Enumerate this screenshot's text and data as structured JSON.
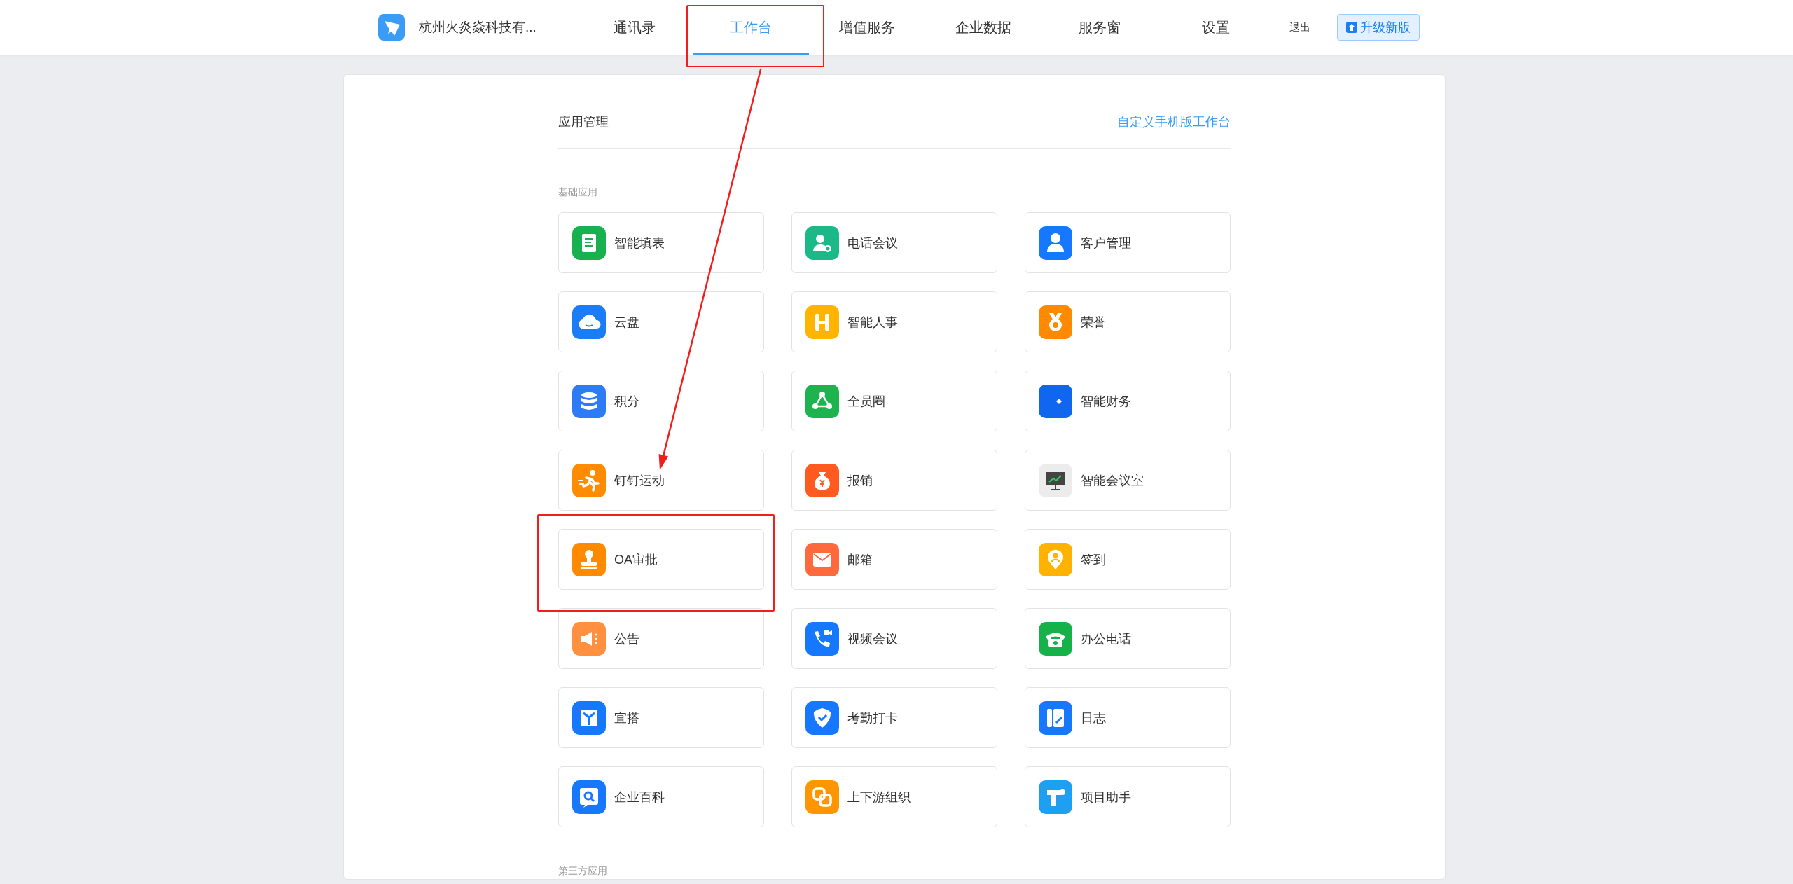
{
  "header": {
    "company": "杭州火炎焱科技有...",
    "tabs": [
      {
        "label": "通讯录",
        "selected": false,
        "highlighted": false
      },
      {
        "label": "工作台",
        "selected": true,
        "highlighted": true
      },
      {
        "label": "增值服务",
        "selected": false,
        "highlighted": false
      },
      {
        "label": "企业数据",
        "selected": false,
        "highlighted": false
      },
      {
        "label": "服务窗",
        "selected": false,
        "highlighted": false
      },
      {
        "label": "设置",
        "selected": false,
        "highlighted": false
      }
    ],
    "logout": "退出",
    "upgrade_button": "升级新版"
  },
  "panel": {
    "title": "应用管理",
    "customize_link": "自定义手机版工作台",
    "sections": [
      {
        "title": "基础应用",
        "apps": [
          {
            "label": "智能填表",
            "color": "#19b14f",
            "highlighted": false
          },
          {
            "label": "电话会议",
            "color": "#1bb987",
            "highlighted": false
          },
          {
            "label": "客户管理",
            "color": "#1677ff",
            "highlighted": false
          },
          {
            "label": "云盘",
            "color": "#1a7df5",
            "highlighted": false
          },
          {
            "label": "智能人事",
            "color": "#ffb400",
            "highlighted": false
          },
          {
            "label": "荣誉",
            "color": "#ff8a00",
            "highlighted": false
          },
          {
            "label": "积分",
            "color": "#2d7cf6",
            "highlighted": false
          },
          {
            "label": "全员圈",
            "color": "#1db34e",
            "highlighted": false
          },
          {
            "label": "智能财务",
            "color": "#1166f0",
            "highlighted": false
          },
          {
            "label": "钉钉运动",
            "color": "#ff8c00",
            "highlighted": false
          },
          {
            "label": "报销",
            "color": "#ff5a1f",
            "highlighted": false
          },
          {
            "label": "智能会议室",
            "color": "#ececec",
            "highlighted": false
          },
          {
            "label": "OA审批",
            "color": "#ff8a00",
            "highlighted": true
          },
          {
            "label": "邮箱",
            "color": "#ff6a3d",
            "highlighted": false
          },
          {
            "label": "签到",
            "color": "#ffb300",
            "highlighted": false
          },
          {
            "label": "公告",
            "color": "#ff9040",
            "highlighted": false
          },
          {
            "label": "视频会议",
            "color": "#1677ff",
            "highlighted": false
          },
          {
            "label": "办公电话",
            "color": "#17b14a",
            "highlighted": false
          },
          {
            "label": "宜搭",
            "color": "#1677ff",
            "highlighted": false
          },
          {
            "label": "考勤打卡",
            "color": "#1677ff",
            "highlighted": false
          },
          {
            "label": "日志",
            "color": "#1677ff",
            "highlighted": false
          },
          {
            "label": "企业百科",
            "color": "#1677ff",
            "highlighted": false
          },
          {
            "label": "上下游组织",
            "color": "#ff9500",
            "highlighted": false
          },
          {
            "label": "项目助手",
            "color": "#1ea0f2",
            "highlighted": false
          }
        ]
      },
      {
        "title": "第三方应用"
      }
    ]
  },
  "annotations": {
    "arrow": true
  }
}
